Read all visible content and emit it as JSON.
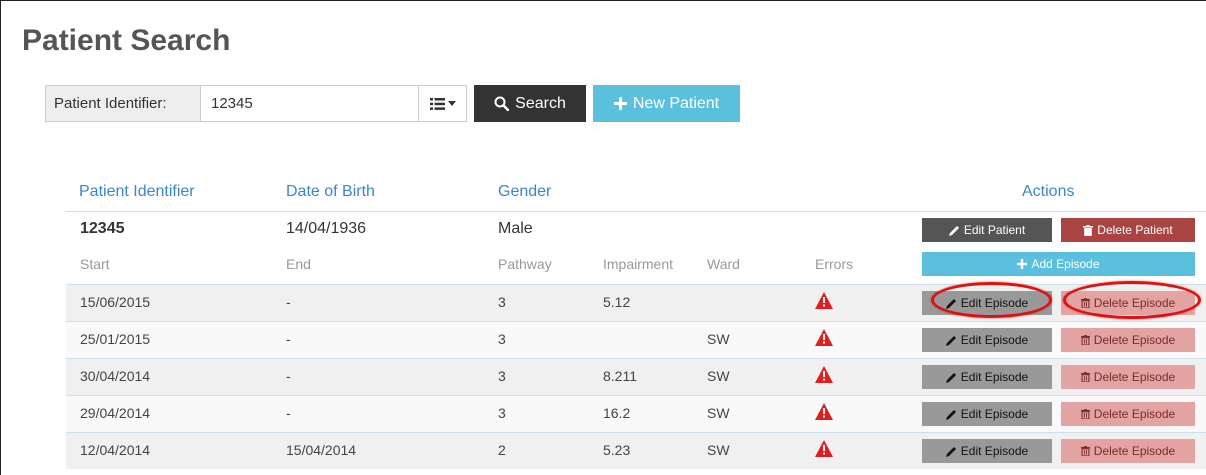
{
  "page": {
    "title": "Patient Search"
  },
  "search": {
    "label": "Patient Identifier:",
    "value": "12345",
    "list_toggle_icon": "list-icon",
    "search_button": "Search",
    "new_patient_button": "New Patient"
  },
  "table": {
    "headers": {
      "patient_identifier": "Patient Identifier",
      "date_of_birth": "Date of Birth",
      "gender": "Gender",
      "actions": "Actions"
    },
    "patient": {
      "identifier": "12345",
      "date_of_birth": "14/04/1936",
      "gender": "Male",
      "edit_button": "Edit Patient",
      "delete_button": "Delete Patient"
    },
    "episode_headers": {
      "start": "Start",
      "end": "End",
      "pathway": "Pathway",
      "impairment": "Impairment",
      "ward": "Ward",
      "errors": "Errors"
    },
    "add_episode_button": "Add Episode",
    "episode_edit_label": "Edit Episode",
    "episode_delete_label": "Delete Episode",
    "episodes": [
      {
        "start": "15/06/2015",
        "end": "-",
        "pathway": "3",
        "impairment": "5.12",
        "ward": "",
        "has_error": true
      },
      {
        "start": "25/01/2015",
        "end": "-",
        "pathway": "3",
        "impairment": "",
        "ward": "SW",
        "has_error": true
      },
      {
        "start": "30/04/2014",
        "end": "-",
        "pathway": "3",
        "impairment": "8.211",
        "ward": "SW",
        "has_error": true
      },
      {
        "start": "29/04/2014",
        "end": "-",
        "pathway": "3",
        "impairment": "16.2",
        "ward": "SW",
        "has_error": true
      },
      {
        "start": "12/04/2014",
        "end": "15/04/2014",
        "pathway": "2",
        "impairment": "5.23",
        "ward": "SW",
        "has_error": true
      }
    ]
  },
  "colors": {
    "header_link": "#3a87c8",
    "search_button": "#333333",
    "new_patient_button": "#5bc0de",
    "edit_patient_button": "#555555",
    "delete_patient_button": "#a94442",
    "add_episode_button": "#5bc0de",
    "edit_episode_button": "#999999",
    "delete_episode_button": "#e3a3a2",
    "error_icon": "#e02020",
    "highlight_ring": "#e01010"
  }
}
